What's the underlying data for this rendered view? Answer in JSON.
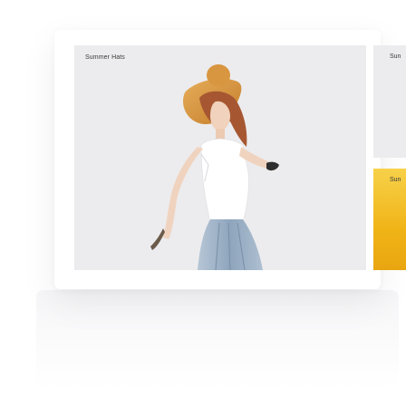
{
  "carousel": {
    "feature": {
      "label": "Summer Hats",
      "image_icon": "woman-in-sunhat-photo"
    },
    "side_top": {
      "label": "Sun"
    },
    "side_bottom": {
      "label": "Sun"
    }
  },
  "colors": {
    "card_bg": "#ececee",
    "hat": "#d7913a",
    "hair": "#a65732",
    "top": "#ffffff",
    "skirt": "#9cb0c6",
    "accent_yellow": "#f0b417"
  }
}
